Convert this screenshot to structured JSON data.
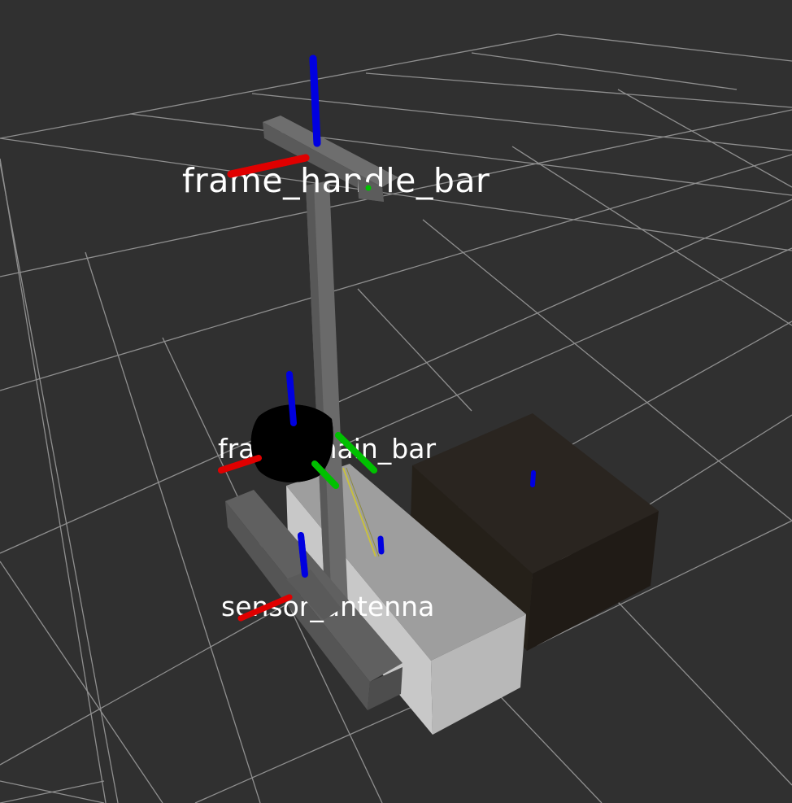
{
  "viewport": {
    "background": "#303030",
    "grid_color": "#a0a0a0"
  },
  "frames": {
    "handle_bar": {
      "label": "frame_handle_bar"
    },
    "main_bar": {
      "label": "frame_main_bar"
    },
    "sensor_antenna": {
      "label": "sensor_antenna"
    }
  },
  "axis_colors": {
    "x": "#e00000",
    "y": "#00c000",
    "z": "#0000e0"
  },
  "link_colors": {
    "rail": "#5f5f5f",
    "base_top": "#b0b0b0",
    "base_front": "#c4c4c4",
    "battery_box": "#2a2520"
  }
}
